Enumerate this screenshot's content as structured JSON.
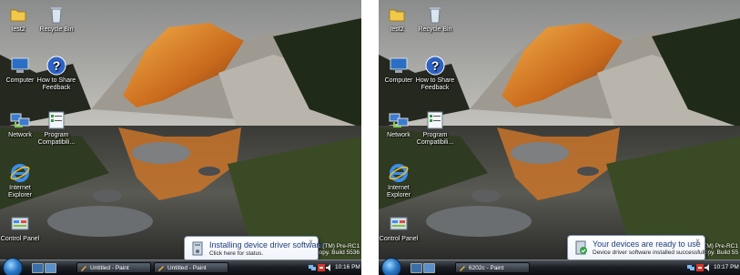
{
  "left_screen": {
    "desktop_icons": [
      {
        "id": "test2",
        "label": "test2",
        "icon": "folder-icon"
      },
      {
        "id": "recycle-bin",
        "label": "Recycle Bin",
        "icon": "recycle-bin-icon"
      },
      {
        "id": "computer",
        "label": "Computer",
        "icon": "computer-icon"
      },
      {
        "id": "how-to-share",
        "label": "How to Share\nFeedback",
        "icon": "help-icon"
      },
      {
        "id": "network",
        "label": "Network",
        "icon": "network-icon"
      },
      {
        "id": "program-compat",
        "label": "Program\nCompatibili...",
        "icon": "program-icon"
      },
      {
        "id": "internet-explorer",
        "label": "Internet\nExplorer",
        "icon": "ie-icon"
      },
      {
        "id": "control-panel",
        "label": "Control Panel",
        "icon": "control-panel-icon"
      }
    ],
    "watermark": {
      "line1": "Windows Vista (TM) Pre-RC1",
      "line2": "Evaluation copy. Build 5536"
    },
    "balloon": {
      "title": "Installing device driver software",
      "text": "Click here for status.",
      "close": "x",
      "icon": "device-install-icon"
    },
    "taskbar": {
      "buttons": [
        {
          "label": "Untitled - Paint",
          "icon": "paint-icon"
        },
        {
          "label": "Untitled - Paint",
          "icon": "paint-icon"
        }
      ],
      "clock": "10:16 PM"
    }
  },
  "right_screen": {
    "desktop_icons": [
      {
        "id": "test2",
        "label": "test2",
        "icon": "folder-icon"
      },
      {
        "id": "recycle-bin",
        "label": "Recycle Bin",
        "icon": "recycle-bin-icon"
      },
      {
        "id": "computer",
        "label": "Computer",
        "icon": "computer-icon"
      },
      {
        "id": "how-to-share",
        "label": "How to Share\nFeedback",
        "icon": "help-icon"
      },
      {
        "id": "network",
        "label": "Network",
        "icon": "network-icon"
      },
      {
        "id": "program-compat",
        "label": "Program\nCompatibili...",
        "icon": "program-icon"
      },
      {
        "id": "internet-explorer",
        "label": "Internet\nExplorer",
        "icon": "ie-icon"
      },
      {
        "id": "control-panel",
        "label": "Control Panel",
        "icon": "control-panel-icon"
      }
    ],
    "watermark": {
      "line1": "Vista (TM) Pre-RC1",
      "line2": "copy. Build 55"
    },
    "balloon": {
      "title": "Your devices are ready to use",
      "text": "Device driver software installed successfully.",
      "close": "x",
      "icon": "device-ready-icon"
    },
    "taskbar": {
      "buttons": [
        {
          "label": "6202c - Paint",
          "icon": "paint-icon"
        }
      ],
      "clock": "10:17 PM"
    }
  },
  "colors": {
    "balloon_title": "#1f3d7a",
    "taskbar": "#1c2026",
    "sky": "#c9c7c0",
    "sunlit_peak": "#e08a2a"
  }
}
